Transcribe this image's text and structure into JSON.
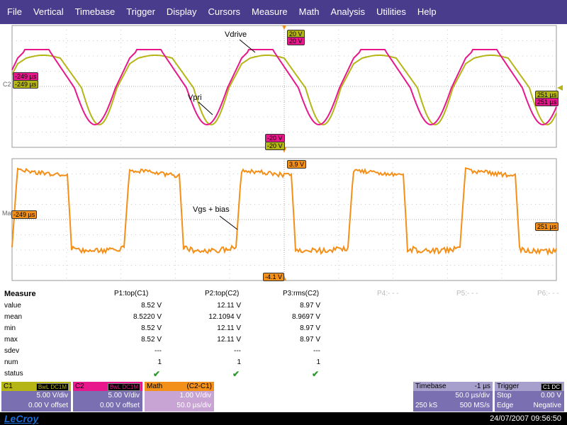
{
  "menu": [
    "File",
    "Vertical",
    "Timebase",
    "Trigger",
    "Display",
    "Cursors",
    "Measure",
    "Math",
    "Analysis",
    "Utilities",
    "Help"
  ],
  "grid_top": {
    "tag_top_c2": "20 V",
    "tag_top_c1": "20 V",
    "tag_bottom_c1": "-20 V",
    "tag_bottom_c2": "-20 V",
    "tag_left_c1": "-249 µs",
    "tag_left_c2": "-249 µs",
    "tag_right_c2": "251 µs",
    "tag_right_c1": "251 µs",
    "channel_label": "C2",
    "label_vdrive": "Vdrive",
    "label_vpri": "Vpri"
  },
  "grid_bottom": {
    "tag_top": "3.9 V",
    "tag_bottom": "-4.1 V",
    "tag_left": "-249 µs",
    "tag_right": "251 µs",
    "channel_label": "Ma",
    "label_vgs": "Vgs + bias"
  },
  "colors": {
    "c1": "#e8178c",
    "c2": "#b5b516",
    "math": "#f39019",
    "menu": "#4a3c8c"
  },
  "measure": {
    "title": "Measure",
    "row_labels": [
      "value",
      "mean",
      "min",
      "max",
      "sdev",
      "num",
      "status"
    ],
    "params": [
      {
        "name": "P1:top(C1)",
        "values": [
          "8.52 V",
          "8.5220 V",
          "8.52 V",
          "8.52 V",
          "---",
          "1"
        ]
      },
      {
        "name": "P2:top(C2)",
        "values": [
          "12.11 V",
          "12.1094 V",
          "12.11 V",
          "12.11 V",
          "---",
          "1"
        ]
      },
      {
        "name": "P3:rms(C2)",
        "values": [
          "8.97 V",
          "8.9697 V",
          "8.97 V",
          "8.97 V",
          "---",
          "1"
        ]
      }
    ],
    "empty_params": [
      "P4:- - -",
      "P5:- - -",
      "P6:- - -"
    ],
    "status_mark": "✔"
  },
  "descriptors": {
    "c1": {
      "name": "C1",
      "badge": "BwL DC1M",
      "scale": "5.00 V/div",
      "offset": "0.00 V offset"
    },
    "c2": {
      "name": "C2",
      "badge": "BwL DC1M",
      "scale": "5.00 V/div",
      "offset": "0.00 V offset"
    },
    "math": {
      "name": "Math",
      "source": "(C2-C1)",
      "scale": "1.00 V/div",
      "time": "50.0 µs/div"
    },
    "timebase": {
      "name": "Timebase",
      "delay": "-1 µs",
      "tdiv": "50.0 µs/div",
      "samples": "250 kS",
      "rate": "500 MS/s"
    },
    "trigger": {
      "name": "Trigger",
      "badge": "C1 DC",
      "mode": "Stop",
      "level": "0.00 V",
      "type": "Edge",
      "slope": "Negative"
    }
  },
  "status": {
    "logo": "LeCroy",
    "datetime": "24/07/2007 09:56:50"
  }
}
